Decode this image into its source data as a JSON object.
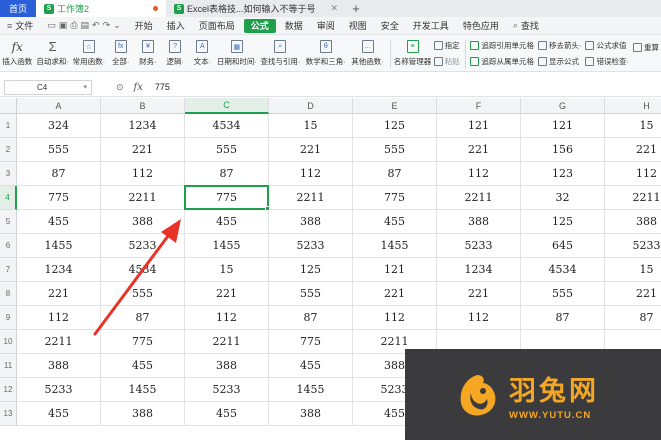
{
  "titlebar": {
    "tabs": [
      {
        "label": "首页",
        "kind": "home"
      },
      {
        "label": "工作簿2",
        "kind": "workbook"
      },
      {
        "label": "Excel表格技...如何输入不等于号",
        "kind": "doc"
      }
    ],
    "add": "+"
  },
  "menubar": {
    "hamburger": "≡",
    "file": "文件",
    "items": [
      "开始",
      "插入",
      "页面布局",
      "公式",
      "数据",
      "审阅",
      "视图",
      "安全",
      "开发工具",
      "特色应用"
    ],
    "active": "公式",
    "search": "查找"
  },
  "ribbon": {
    "insert_function": "插入函数",
    "autosum": "自动求和·",
    "common": "常用函数·",
    "all": "全部·",
    "finance": "财务·",
    "logic": "逻辑·",
    "text": "文本·",
    "datetime": "日期和时间·",
    "lookup": "查找与引用·",
    "math": "数学和三角·",
    "other": "其他函数·",
    "name_manager": "名称管理器",
    "specify": "指定",
    "paste": "粘贴",
    "trace_precedents": "追踪引用单元格",
    "trace_dependents": "追踪从属单元格",
    "move_arrows": "移去箭头·",
    "show_formulas": "显示公式",
    "evaluate": "公式求值",
    "error_check": "错误检查·",
    "recalc": "重算"
  },
  "formula_bar": {
    "cell_ref": "C4",
    "fx": "fx",
    "value": "775"
  },
  "sheet": {
    "columns": [
      "A",
      "B",
      "C",
      "D",
      "E",
      "F",
      "G",
      "H"
    ],
    "selected_column": "C",
    "selected_row": 4,
    "rows": [
      {
        "n": "1",
        "cells": [
          "324",
          "1234",
          "4534",
          "15",
          "125",
          "121",
          "121",
          "15"
        ]
      },
      {
        "n": "2",
        "cells": [
          "555",
          "221",
          "555",
          "221",
          "555",
          "221",
          "156",
          "221"
        ]
      },
      {
        "n": "3",
        "cells": [
          "87",
          "112",
          "87",
          "112",
          "87",
          "112",
          "123",
          "112"
        ]
      },
      {
        "n": "4",
        "cells": [
          "775",
          "2211",
          "775",
          "2211",
          "775",
          "2211",
          "32",
          "2211"
        ]
      },
      {
        "n": "5",
        "cells": [
          "455",
          "388",
          "455",
          "388",
          "455",
          "388",
          "125",
          "388"
        ]
      },
      {
        "n": "6",
        "cells": [
          "1455",
          "5233",
          "1455",
          "5233",
          "1455",
          "5233",
          "645",
          "5233"
        ]
      },
      {
        "n": "7",
        "cells": [
          "1234",
          "4534",
          "15",
          "125",
          "121",
          "1234",
          "4534",
          "15"
        ]
      },
      {
        "n": "8",
        "cells": [
          "221",
          "555",
          "221",
          "555",
          "221",
          "221",
          "555",
          "221"
        ]
      },
      {
        "n": "9",
        "cells": [
          "112",
          "87",
          "112",
          "87",
          "112",
          "112",
          "87",
          "87"
        ]
      },
      {
        "n": "10",
        "cells": [
          "2211",
          "775",
          "2211",
          "775",
          "2211",
          "",
          "",
          ""
        ]
      },
      {
        "n": "11",
        "cells": [
          "388",
          "455",
          "388",
          "455",
          "388",
          "",
          "",
          ""
        ]
      },
      {
        "n": "12",
        "cells": [
          "5233",
          "1455",
          "5233",
          "1455",
          "5233",
          "",
          "",
          ""
        ]
      },
      {
        "n": "13",
        "cells": [
          "455",
          "388",
          "455",
          "388",
          "455",
          "",
          "",
          ""
        ]
      }
    ]
  },
  "watermark": {
    "title": "羽兔网",
    "url": "WWW.YUTU.CN"
  }
}
